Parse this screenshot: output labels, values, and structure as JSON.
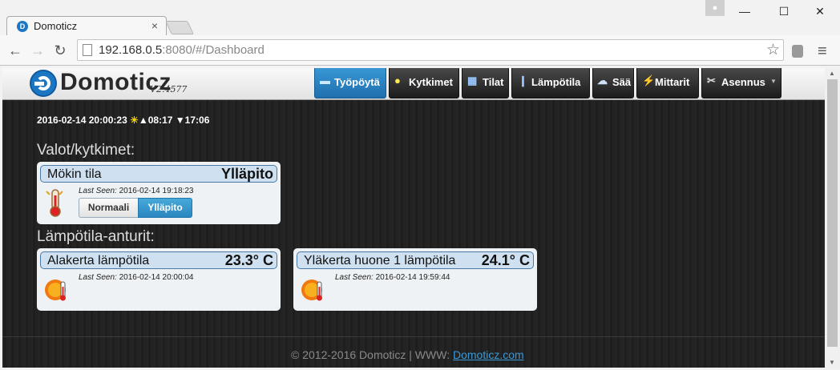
{
  "browser": {
    "tab_title": "Domoticz",
    "tab_close": "×",
    "favicon_letter": "D",
    "url_host": "192.168.0.5",
    "url_rest": ":8080/#/Dashboard",
    "back": "←",
    "forward": "→",
    "reload": "↻",
    "star": "☆",
    "menu": "≡",
    "minimize": "—",
    "maximize": "☐",
    "close": "✕"
  },
  "app": {
    "brand": "Domoticz",
    "version": "V2.4577"
  },
  "nav": [
    {
      "label": "Työpöytä",
      "icon": "monitor-icon",
      "glyph": "▬",
      "active": true
    },
    {
      "label": "Kytkimet",
      "icon": "lightbulb-icon",
      "glyph": "💡",
      "active": false
    },
    {
      "label": "Tilat",
      "icon": "scene-icon",
      "glyph": "🎬",
      "active": false
    },
    {
      "label": "Lämpötila",
      "icon": "thermometer-icon",
      "glyph": "🌡",
      "active": false
    },
    {
      "label": "Sää",
      "icon": "weather-icon",
      "glyph": "☁",
      "active": false
    },
    {
      "label": "Mittarit",
      "icon": "meter-icon",
      "glyph": "⚡",
      "active": false
    },
    {
      "label": "Asennus",
      "icon": "tools-icon",
      "glyph": "✂",
      "active": false,
      "dropdown": true
    }
  ],
  "clock": {
    "datetime": "2016-02-14 20:00:23",
    "sun_icon": "☀",
    "sunrise": "▲08:17",
    "sunset": "▼17:06"
  },
  "sections": {
    "switches_title": "Valot/kytkimet:",
    "temps_title": "Lämpötila-anturit:"
  },
  "switch_card": {
    "name": "Mökin tila",
    "value": "Ylläpito",
    "last_seen_label": "Last Seen:",
    "last_seen": "2016-02-14 19:18:23",
    "buttons": [
      "Normaali",
      "Ylläpito"
    ],
    "selected": "Ylläpito"
  },
  "temp_cards": [
    {
      "name": "Alakerta lämpötila",
      "value": "23.3° C",
      "last_seen_label": "Last Seen:",
      "last_seen": "2016-02-14 20:00:04"
    },
    {
      "name": "Yläkerta huone 1 lämpötila",
      "value": "24.1° C",
      "last_seen_label": "Last Seen:",
      "last_seen": "2016-02-14 19:59:44"
    }
  ],
  "footer": {
    "text": "© 2012-2016 Domoticz | WWW: ",
    "link": "Domoticz.com"
  },
  "colors": {
    "accent": "#2a86bf",
    "card_header": "#cfe0f0",
    "background": "#202020",
    "link": "#3a9ad9"
  }
}
